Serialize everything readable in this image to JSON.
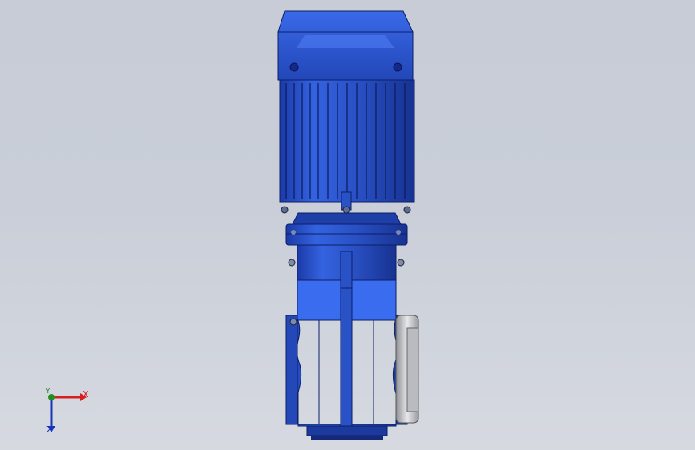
{
  "viewport": {
    "background_top": "#c7ccd7",
    "background_bottom": "#d6d9e0"
  },
  "model": {
    "description_icon": "gear-motor-3d-model-icon",
    "body_color": "#2f5fd6",
    "dark_color": "#1a3a9e",
    "highlight_color": "#5b86ff",
    "flange_color": "#c8c8c8"
  },
  "triad": {
    "x_label": "X",
    "y_label": "Y",
    "z_label": "Z",
    "x_color": "#d42020",
    "y_color": "#1f8f1f",
    "z_color": "#1a35b8"
  }
}
